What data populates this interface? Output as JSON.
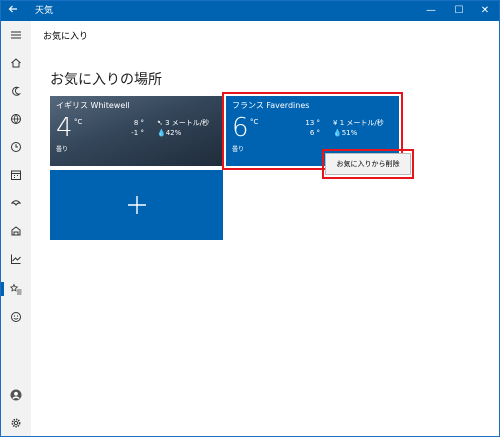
{
  "titlebar": {
    "title": "天気",
    "back_icon": "back-arrow-icon",
    "minimize": "—",
    "maximize": "☐",
    "close": "✕",
    "bg": "#0063b1"
  },
  "header": {
    "title": "お気に入り"
  },
  "sidebar": {
    "items": [
      {
        "icon": "hamburger-menu-icon"
      },
      {
        "icon": "home-icon"
      },
      {
        "icon": "forecast-moon-icon"
      },
      {
        "icon": "globe-icon"
      },
      {
        "icon": "clock-icon"
      },
      {
        "icon": "calendar-icon"
      },
      {
        "icon": "umbrella-icon"
      },
      {
        "icon": "news-icon"
      },
      {
        "icon": "chart-icon"
      },
      {
        "icon": "favorites-icon",
        "active": true
      },
      {
        "icon": "smiley-icon"
      },
      {
        "icon": "account-icon"
      },
      {
        "icon": "settings-icon"
      }
    ]
  },
  "main": {
    "section_title": "お気に入りの場所",
    "tiles": [
      {
        "place": "イギリス Whitewell",
        "temp": "4",
        "unit": "°C",
        "condition": "曇り",
        "high": "8 °",
        "low": "-1 °",
        "wind": "3 メートル/秒",
        "humidity": "42%"
      },
      {
        "place": "フランス Faverdines",
        "temp": "6",
        "unit": "°C",
        "condition": "曇り",
        "high": "13 °",
        "low": "6 °",
        "wind": "1 メートル/秒",
        "humidity": "51%"
      }
    ],
    "add_tile_label": "+"
  },
  "context_menu": {
    "remove_label": "お気に入りから削除"
  },
  "colors": {
    "accent": "#0063b1",
    "tile_blue": "#0063b1",
    "highlight": "#e8141b"
  }
}
